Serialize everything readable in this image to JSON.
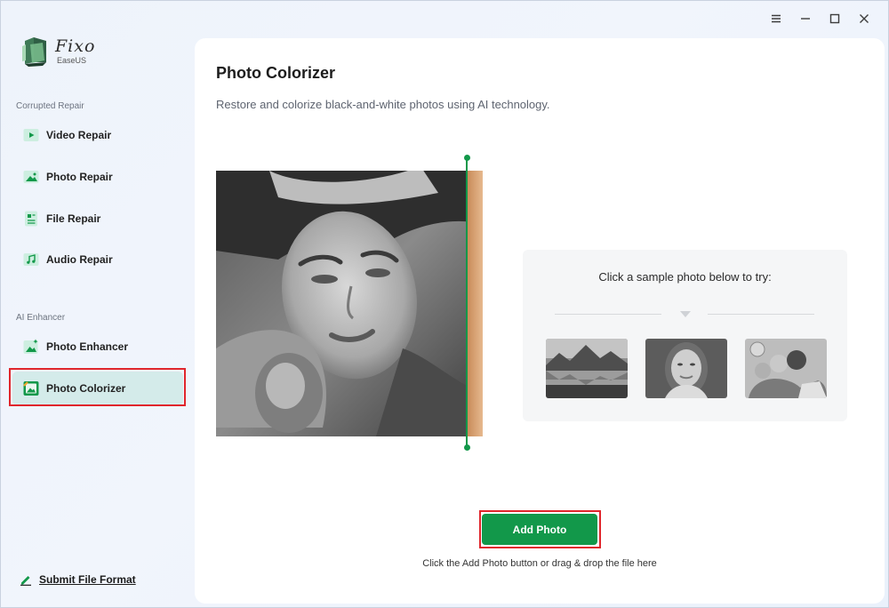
{
  "app": {
    "logo_name": "Fixo",
    "logo_sub": "EaseUS"
  },
  "window_controls": [
    "menu",
    "minimize",
    "maximize",
    "close"
  ],
  "sidebar": {
    "sections": [
      {
        "label": "Corrupted Repair"
      },
      {
        "label": "AI Enhancer"
      }
    ],
    "items": [
      {
        "label": "Video Repair",
        "icon": "video-icon"
      },
      {
        "label": "Photo Repair",
        "icon": "photo-icon"
      },
      {
        "label": "File Repair",
        "icon": "file-icon"
      },
      {
        "label": "Audio Repair",
        "icon": "audio-icon"
      },
      {
        "label": "Photo Enhancer",
        "icon": "enhancer-icon"
      },
      {
        "label": "Photo Colorizer",
        "icon": "colorizer-icon",
        "active": true
      }
    ],
    "submit_label": "Submit File Format"
  },
  "main": {
    "title": "Photo Colorizer",
    "subtitle": "Restore and colorize black-and-white photos using AI technology.",
    "sample_title": "Click a sample photo below to try:",
    "samples": [
      "landscape-sample",
      "portrait-sample",
      "family-sample"
    ],
    "add_button": "Add Photo",
    "hint": "Click the Add Photo button or drag & drop the file here"
  },
  "colors": {
    "accent": "#12984a",
    "active_bg": "#d4ebea",
    "highlight": "#e0262c"
  }
}
